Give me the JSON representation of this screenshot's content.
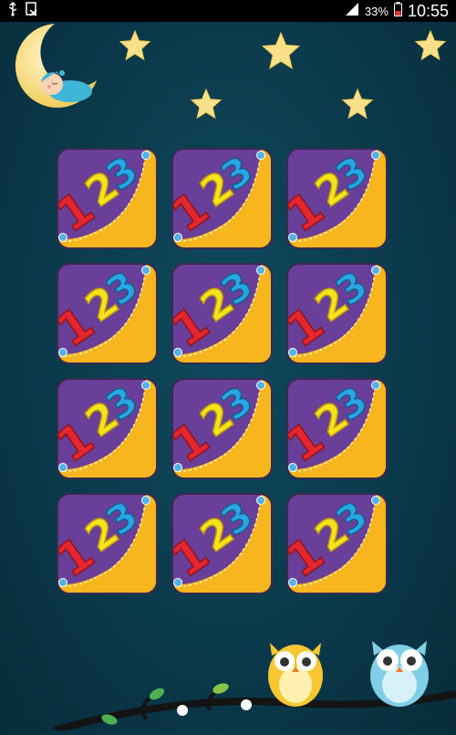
{
  "status_bar": {
    "battery_percent": "33%",
    "time": "10:55",
    "icons": [
      "usb-icon",
      "screenshot-icon",
      "signal-icon",
      "battery-icon"
    ]
  },
  "decorations": {
    "background": "night-sky",
    "moon": "crescent-moon-with-sleeping-baby",
    "stars": 5,
    "owls": [
      "yellow-owl",
      "blue-owl"
    ]
  },
  "board": {
    "rows": 4,
    "columns": 3,
    "card_back": "123-card-back",
    "cards": [
      {
        "id": 1
      },
      {
        "id": 2
      },
      {
        "id": 3
      },
      {
        "id": 4
      },
      {
        "id": 5
      },
      {
        "id": 6
      },
      {
        "id": 7
      },
      {
        "id": 8
      },
      {
        "id": 9
      },
      {
        "id": 10
      },
      {
        "id": 11
      },
      {
        "id": 12
      }
    ]
  },
  "colors": {
    "background": "#0b3a4c",
    "card_purple": "#6a3f9a",
    "card_yellow": "#f7b61e",
    "digit_red": "#e3262f",
    "digit_yellow": "#f6e21d",
    "digit_blue": "#2aa6e6"
  }
}
